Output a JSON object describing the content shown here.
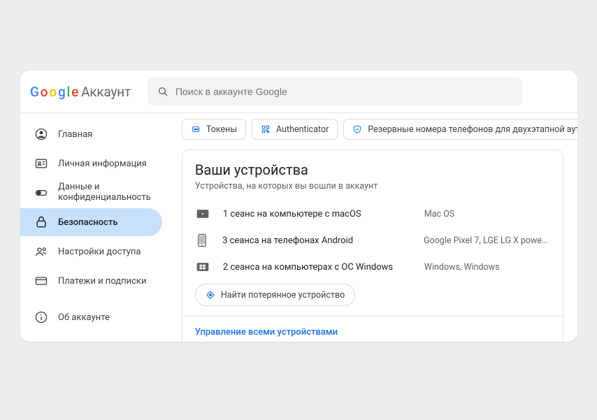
{
  "header": {
    "logo_suffix": "Аккаунт",
    "search_placeholder": "Поиск в аккаунте Google"
  },
  "sidebar": {
    "items": [
      {
        "icon": "user-circle",
        "label": "Главная"
      },
      {
        "icon": "id-card",
        "label": "Личная информация"
      },
      {
        "icon": "toggle",
        "label": "Данные и\nконфиденциальность"
      },
      {
        "icon": "lock",
        "label": "Безопасность"
      },
      {
        "icon": "share-people",
        "label": "Настройки доступа"
      },
      {
        "icon": "credit-card",
        "label": "Платежи и подписки"
      }
    ],
    "about": {
      "icon": "info",
      "label": "Об аккаунте"
    },
    "active_index": 3
  },
  "chips": [
    {
      "icon": "password-dots",
      "label": "Токены",
      "color": "#1a73e8"
    },
    {
      "icon": "qr",
      "label": "Authenticator",
      "color": "#1a73e8"
    },
    {
      "icon": "shield-check",
      "label": "Резервные номера телефонов для двухэтапной аутентификаци",
      "color": "#1a73e8"
    }
  ],
  "devices_card": {
    "title": "Ваши устройства",
    "subtitle": "Устройства, на которых вы вошли в аккаунт",
    "rows": [
      {
        "icon": "mac-box",
        "title": "1 сеанс на компьютере с macOS",
        "detail": "Mac OS"
      },
      {
        "icon": "phone",
        "title": "3 сеанса на телефонах Android",
        "detail": "Google Pixel 7, LGE LG X power, ..."
      },
      {
        "icon": "windows-box",
        "title": "2 сеанса на компьютерах с ОС Windows",
        "detail": "Windows, Windows"
      }
    ],
    "find_label": "Найти потерянное устройство",
    "manage_label": "Управление всеми устройствами"
  }
}
